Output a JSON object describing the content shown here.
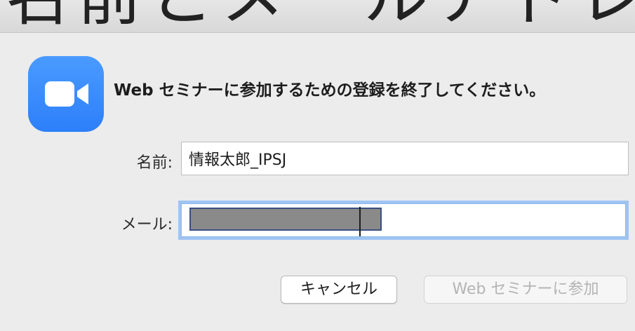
{
  "caption_fragment": "名前とメールアドレスを入力します",
  "dialog": {
    "message": "Web セミナーに参加するための登録を終了してください。",
    "icon": "video-camera-icon",
    "brand_color": "#2d8cff"
  },
  "form": {
    "name_label": "名前:",
    "name_value": "情報太郎_IPSJ",
    "mail_label": "メール:",
    "mail_value": ""
  },
  "buttons": {
    "cancel_label": "キャンセル",
    "join_label": "Web セミナーに参加"
  }
}
